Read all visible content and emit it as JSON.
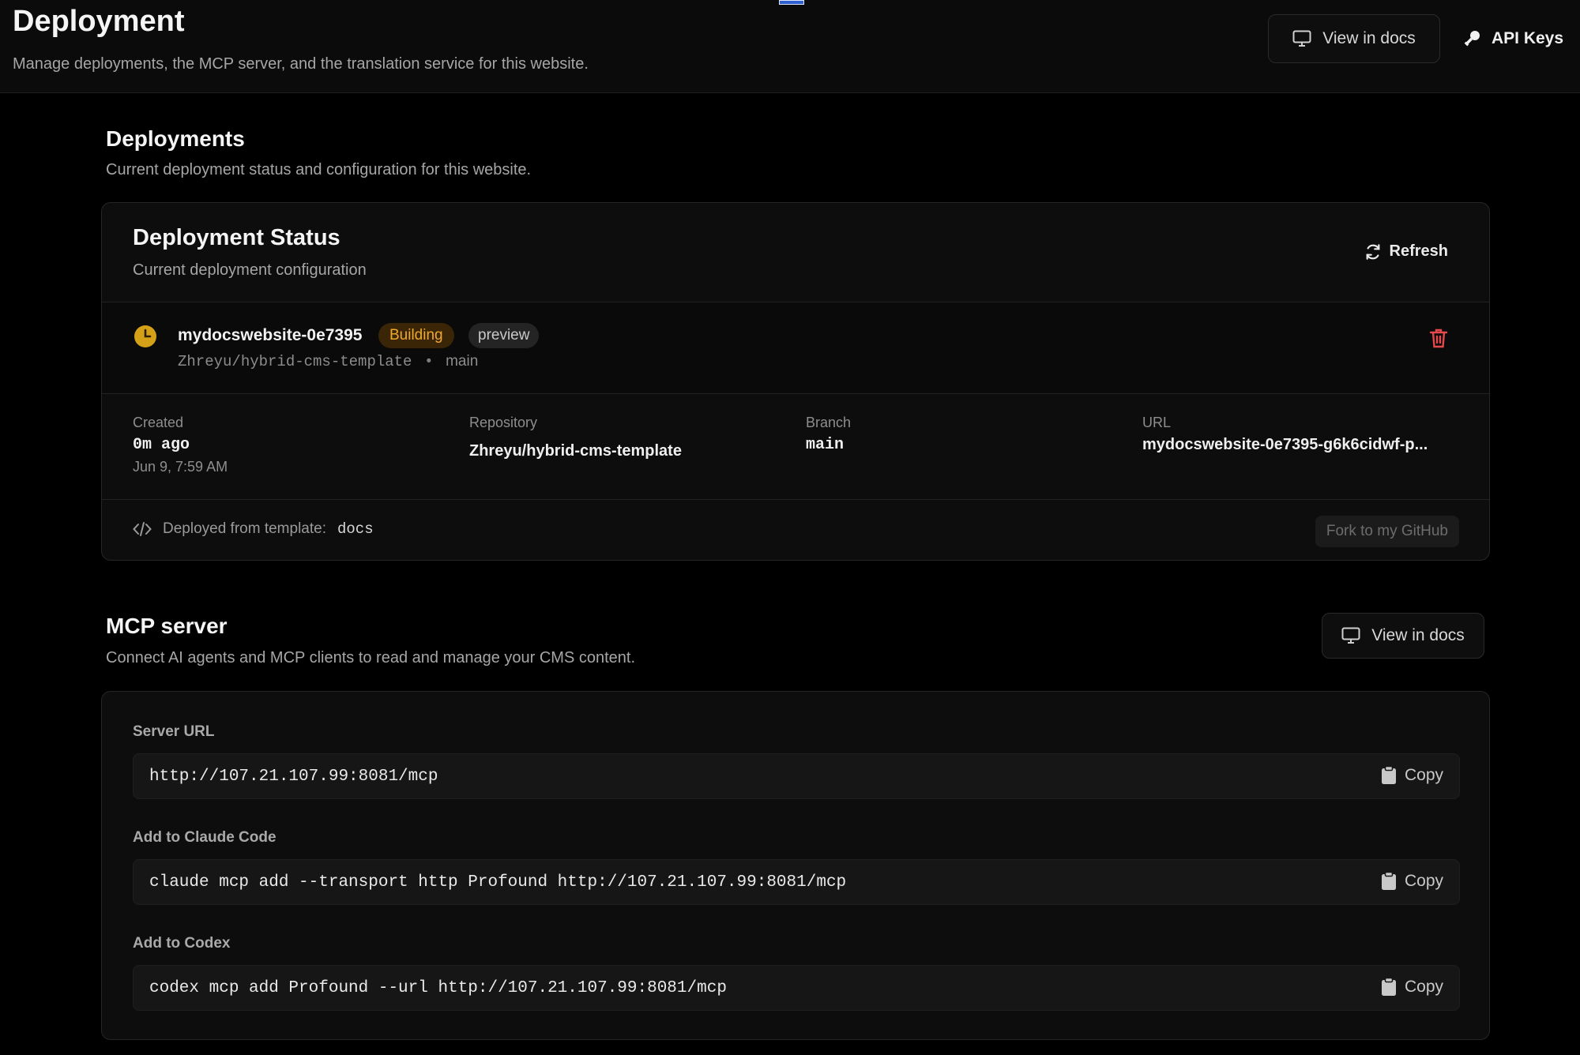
{
  "header": {
    "title": "Deployment",
    "subtitle": "Manage deployments, the MCP server, and the translation service for this website.",
    "view_docs_label": "View in docs",
    "api_keys_label": "API Keys"
  },
  "deployments_section": {
    "title": "Deployments",
    "description": "Current deployment status and configuration for this website."
  },
  "status_card": {
    "title": "Deployment Status",
    "description": "Current deployment configuration",
    "refresh_label": "Refresh",
    "deployment": {
      "name": "mydocswebsite-0e7395",
      "status": "Building",
      "environment": "preview",
      "repo": "Zhreyu/hybrid-cms-template",
      "separator": "•",
      "branch": "main"
    },
    "meta": {
      "created_label": "Created",
      "created_value": "0m ago",
      "created_date": "Jun 9, 7:59 AM",
      "repository_label": "Repository",
      "repository_value": "Zhreyu/hybrid-cms-template",
      "branch_label": "Branch",
      "branch_value": "main",
      "url_label": "URL",
      "url_value": "mydocswebsite-0e7395-g6k6cidwf-p..."
    },
    "template": {
      "prefix": "Deployed from template:",
      "name": "docs",
      "fork_label": "Fork to my GitHub"
    }
  },
  "mcp_section": {
    "title": "MCP server",
    "description": "Connect AI agents and MCP clients to read and manage your CMS content.",
    "view_docs_label": "View in docs",
    "fields": [
      {
        "label": "Server URL",
        "value": "http://107.21.107.99:8081/mcp",
        "copy_label": "Copy"
      },
      {
        "label": "Add to Claude Code",
        "value": "claude mcp add --transport http Profound http://107.21.107.99:8081/mcp",
        "copy_label": "Copy"
      },
      {
        "label": "Add to Codex",
        "value": "codex mcp add Profound --url http://107.21.107.99:8081/mcp",
        "copy_label": "Copy"
      }
    ]
  },
  "colors": {
    "background": "#000000",
    "card": "#0d0d0d",
    "building_badge": "#f0a830",
    "clock": "#d4a017",
    "danger": "#e5484d"
  }
}
